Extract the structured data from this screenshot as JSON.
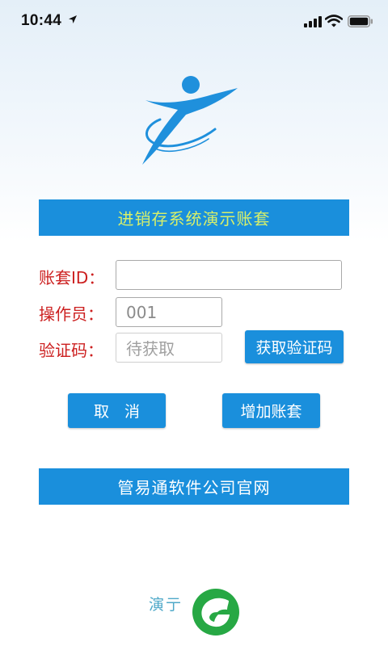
{
  "status_bar": {
    "time": "10:44"
  },
  "header": {
    "title": "进销存系统演示账套"
  },
  "form": {
    "account_label": "账套ID：",
    "account_value": "",
    "operator_label": "操作员：",
    "operator_value": "001",
    "code_label": "验证码：",
    "code_placeholder": "待获取",
    "get_code_label": "获取验证码"
  },
  "actions": {
    "cancel_label": "取　消",
    "add_label": "增加账套"
  },
  "links": {
    "website_label": "管易通软件公司官网"
  },
  "footer": {
    "text": "演亍"
  },
  "colors": {
    "accent": "#1a8fdc",
    "title_text": "#d8f06a",
    "label_red": "#cc1f1f",
    "brand_green": "#27a844"
  }
}
